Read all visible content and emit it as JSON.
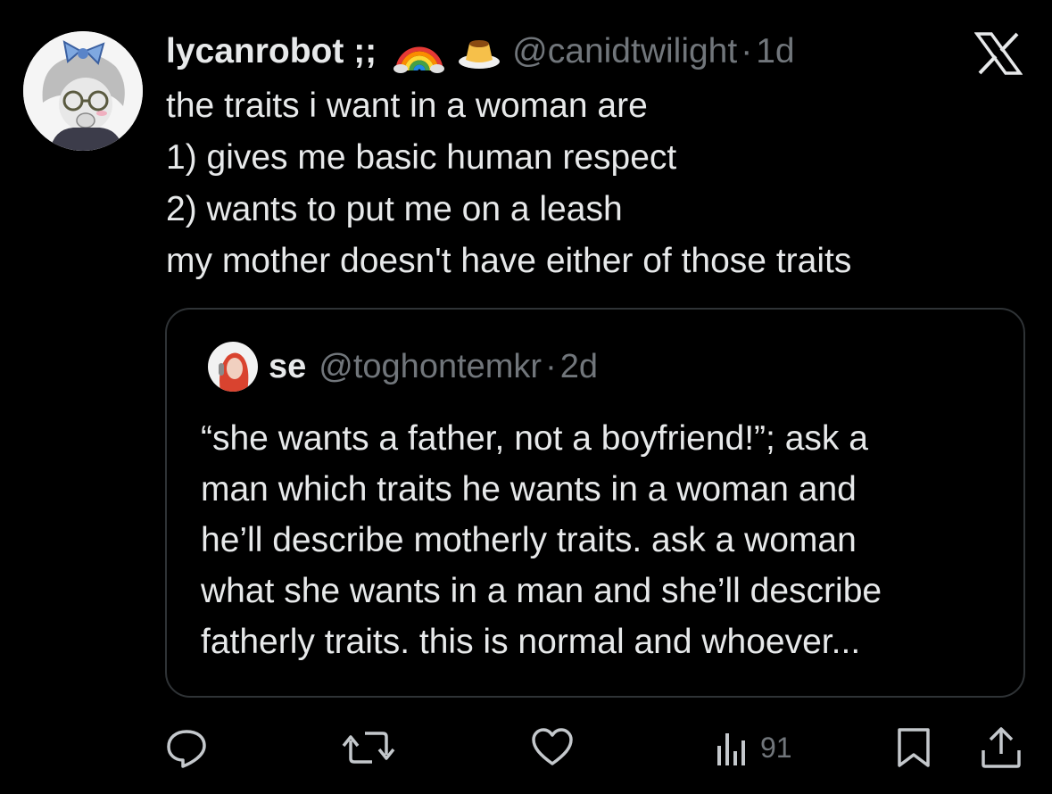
{
  "tweet": {
    "display_name": "lycanrobot ;;",
    "name_emojis": [
      "rainbow-icon",
      "flan-icon"
    ],
    "handle": "@canidtwilight",
    "separator": "·",
    "time": "1d",
    "lines": [
      "the traits i want in a woman are",
      "1) gives me basic human respect",
      "2) wants to put me on a leash",
      "my mother doesn't have either of those traits"
    ]
  },
  "quoted_tweet": {
    "display_name": "se",
    "handle": "@toghontemkr",
    "separator": "·",
    "time": "2d",
    "lines": [
      "“she wants a father, not a boyfriend!”; ask a",
      "man which traits he wants in a woman and",
      "he’ll describe motherly traits. ask a woman",
      "what she wants in a man and she’ll describe",
      "fatherly traits. this is normal and whoever..."
    ]
  },
  "actions": {
    "reply_icon": "reply-icon",
    "retweet_icon": "retweet-icon",
    "like_icon": "heart-icon",
    "views_icon": "views-icon",
    "views_count": "91",
    "bookmark_icon": "bookmark-icon",
    "share_icon": "share-icon"
  },
  "logo": "x-logo-icon",
  "colors": {
    "background": "#000000",
    "text": "#e7e9ea",
    "secondary": "#71767b",
    "border": "#2f3336"
  }
}
